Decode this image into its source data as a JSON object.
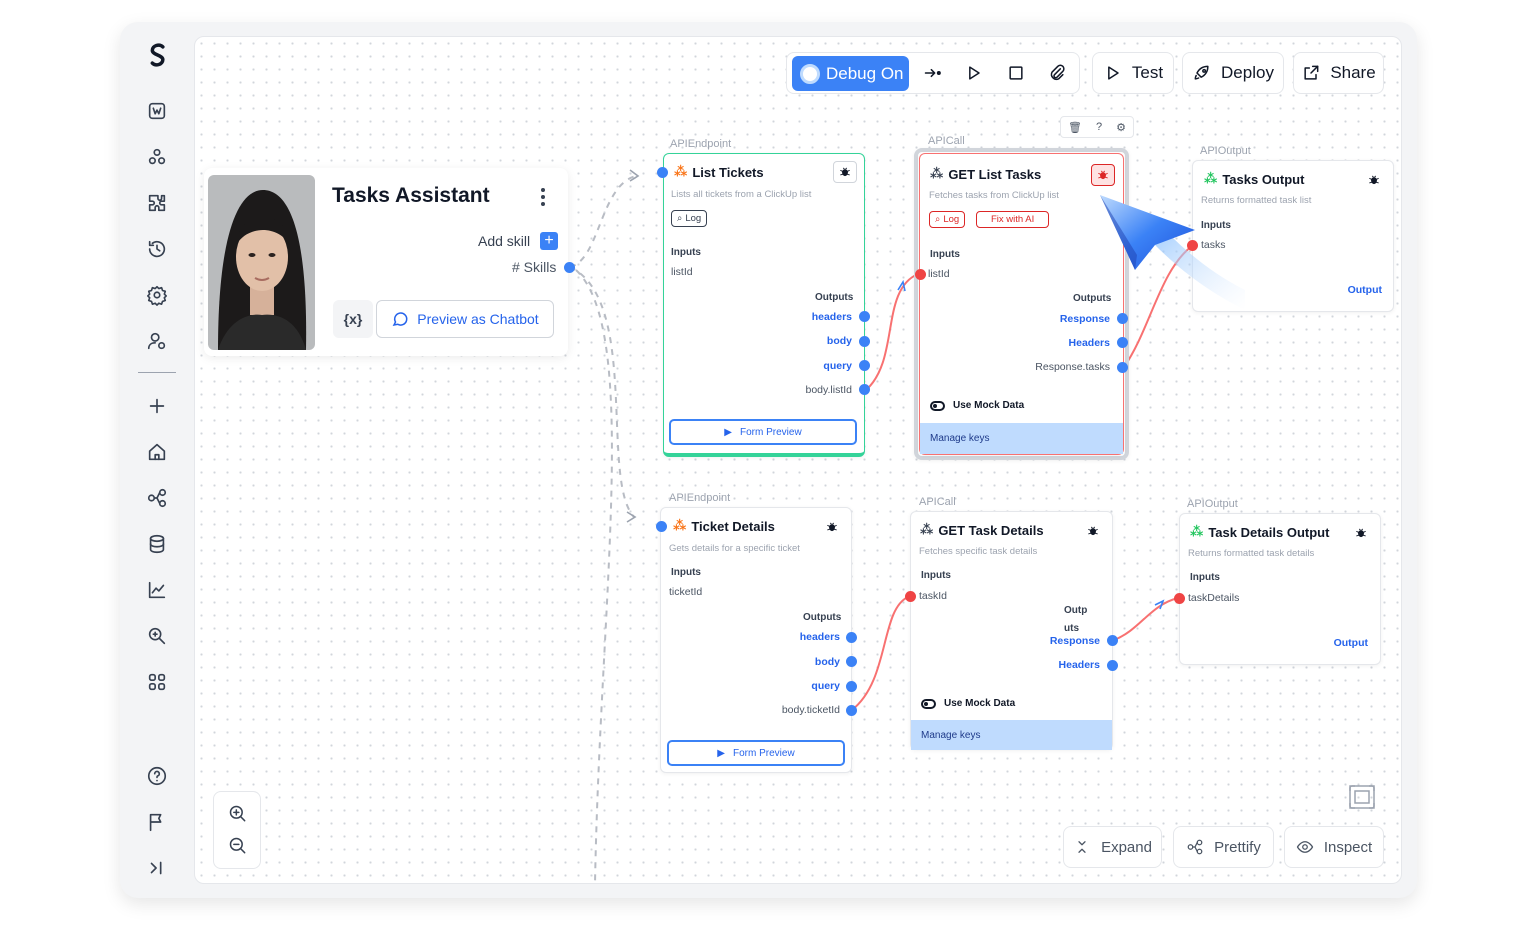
{
  "toolbar": {
    "debug_label": "Debug On",
    "test_label": "Test",
    "deploy_label": "Deploy",
    "share_label": "Share"
  },
  "agent": {
    "name": "Tasks Assistant",
    "add_skill_label": "Add skill",
    "add_skill_symbol": "+",
    "skills_label": "# Skills",
    "variables_symbol": "{x}",
    "preview_label": "Preview as Chatbot"
  },
  "node_tools": {
    "delete": "🗑",
    "help": "?",
    "settings": "⚙"
  },
  "nodes": {
    "list_tickets": {
      "type": "APIEndpoint",
      "title": "List Tickets",
      "desc": "Lists all tickets from a ClickUp list",
      "log": "Log",
      "inputs_head": "Inputs",
      "inputs": [
        "listId"
      ],
      "outputs_head": "Outputs",
      "outputs": [
        "headers",
        "body",
        "query",
        "body.listId"
      ],
      "form_preview": "Form Preview"
    },
    "get_list_tasks": {
      "type": "APICall",
      "title": "GET List Tasks",
      "desc": "Fetches tasks from ClickUp list",
      "log": "Log",
      "fix": "Fix with AI",
      "inputs_head": "Inputs",
      "inputs": [
        "listId"
      ],
      "outputs_head": "Outputs",
      "outputs": [
        "Response",
        "Headers",
        "Response.tasks"
      ],
      "mock": "Use Mock Data",
      "manage": "Manage keys"
    },
    "tasks_output": {
      "type": "APIOutput",
      "title": "Tasks Output",
      "desc": "Returns formatted task list",
      "inputs_head": "Inputs",
      "inputs": [
        "tasks"
      ],
      "output": "Output"
    },
    "ticket_details": {
      "type": "APIEndpoint",
      "title": "Ticket Details",
      "desc": "Gets details for a specific ticket",
      "inputs_head": "Inputs",
      "inputs": [
        "ticketId"
      ],
      "outputs_head": "Outputs",
      "outputs": [
        "headers",
        "body",
        "query",
        "body.ticketId"
      ],
      "form_preview": "Form Preview"
    },
    "get_task_details": {
      "type": "APICall",
      "title": "GET Task Details",
      "desc": "Fetches specific task details",
      "inputs_head": "Inputs",
      "inputs": [
        "taskId"
      ],
      "outputs_head_a": "Outp",
      "outputs_head_b": "uts",
      "outputs": [
        "Response",
        "Headers"
      ],
      "mock": "Use Mock Data",
      "manage": "Manage keys"
    },
    "task_details_output": {
      "type": "APIOutput",
      "title": "Task Details Output",
      "desc": "Returns formatted task details",
      "inputs_head": "Inputs",
      "inputs": [
        "taskDetails"
      ],
      "output": "Output"
    }
  },
  "bottom": {
    "expand_label": "Expand",
    "prettify_label": "Prettify",
    "inspect_label": "Inspect"
  },
  "colors": {
    "accent": "#3b82f6",
    "error": "#ef4444",
    "success_border": "#34d399",
    "manage_bg": "#bfdbfe"
  }
}
